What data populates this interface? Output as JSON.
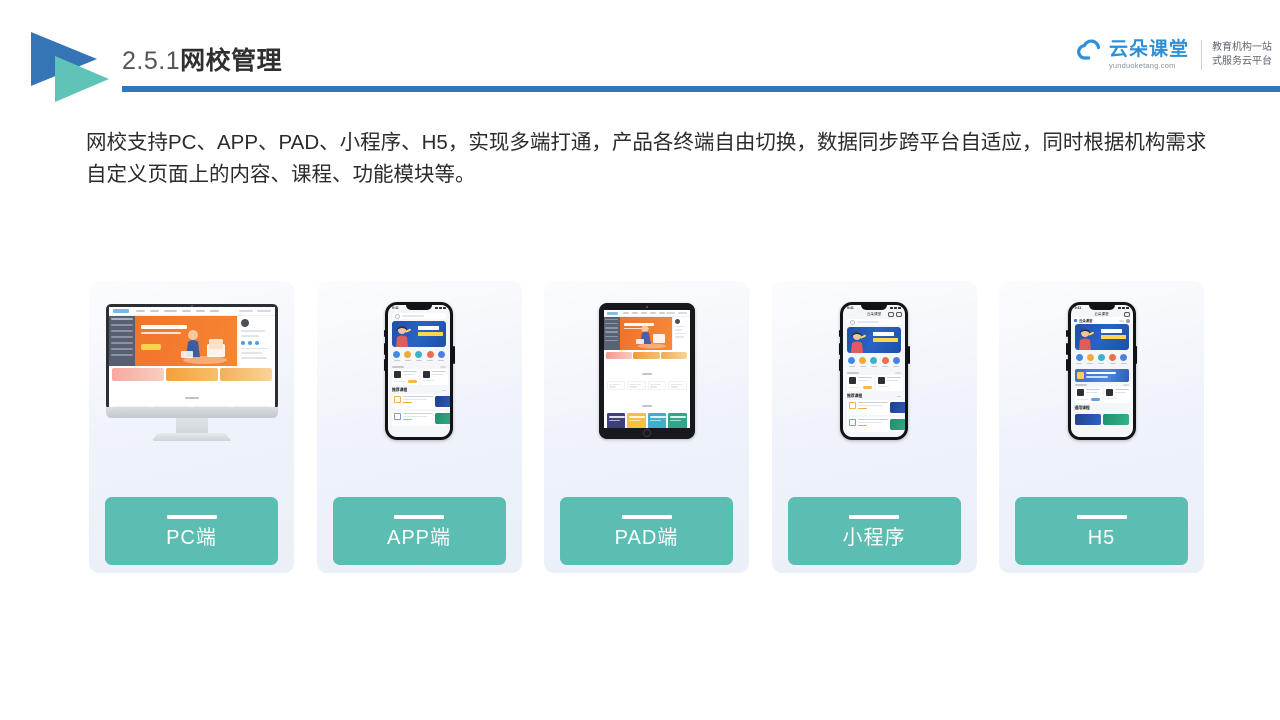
{
  "header": {
    "title_number": "2.5.1",
    "title_name": "网校管理",
    "logo_icon": "double-triangle-play-icon",
    "accent_rule_color": "#2f76ba"
  },
  "brand": {
    "cloud_icon": "cloud-icon",
    "name": "云朵课堂",
    "domain": "yunduoketang.com",
    "tagline_line1": "教育机构一站",
    "tagline_line2": "式服务云平台",
    "color": "#2e8fd6"
  },
  "intro": {
    "paragraph": "网校支持PC、APP、PAD、小程序、H5，实现多端打通，产品各终端自由切换，数据同步跨平台自适应，同时根据机构需求自定义页面上的内容、课程、功能模块等。"
  },
  "cards": {
    "accent_color": "#5cbdb2",
    "background_color": "#eef2f9",
    "items": [
      {
        "label": "PC端",
        "device": "desktop-monitor",
        "device_icon": "desktop-monitor-icon"
      },
      {
        "label": "APP端",
        "device": "phone",
        "device_icon": "smartphone-icon"
      },
      {
        "label": "PAD端",
        "device": "tablet",
        "device_icon": "tablet-icon"
      },
      {
        "label": "小程序",
        "device": "phone-miniprogram",
        "device_icon": "smartphone-icon"
      },
      {
        "label": "H5",
        "device": "phone-h5",
        "device_icon": "smartphone-icon"
      }
    ]
  },
  "device_screens": {
    "phone_app": {
      "status_time": "9:41",
      "banner_headline": "职场人的",
      "banner_subhead": "第一堂写作课",
      "section_title": "推荐课程"
    },
    "phone_miniprogram": {
      "status_time": "9:41",
      "nav_title": "云朵课堂",
      "banner_headline": "职场人的",
      "banner_subhead": "第一堂写作课",
      "section_title": "推荐课程"
    },
    "phone_h5": {
      "status_time": "9:41",
      "nav_title": "云朵课堂",
      "brand_label": "云朵课堂",
      "banner_headline": "职场人的",
      "banner_subhead": "第一堂写作课",
      "section_title": "通用课程"
    }
  }
}
